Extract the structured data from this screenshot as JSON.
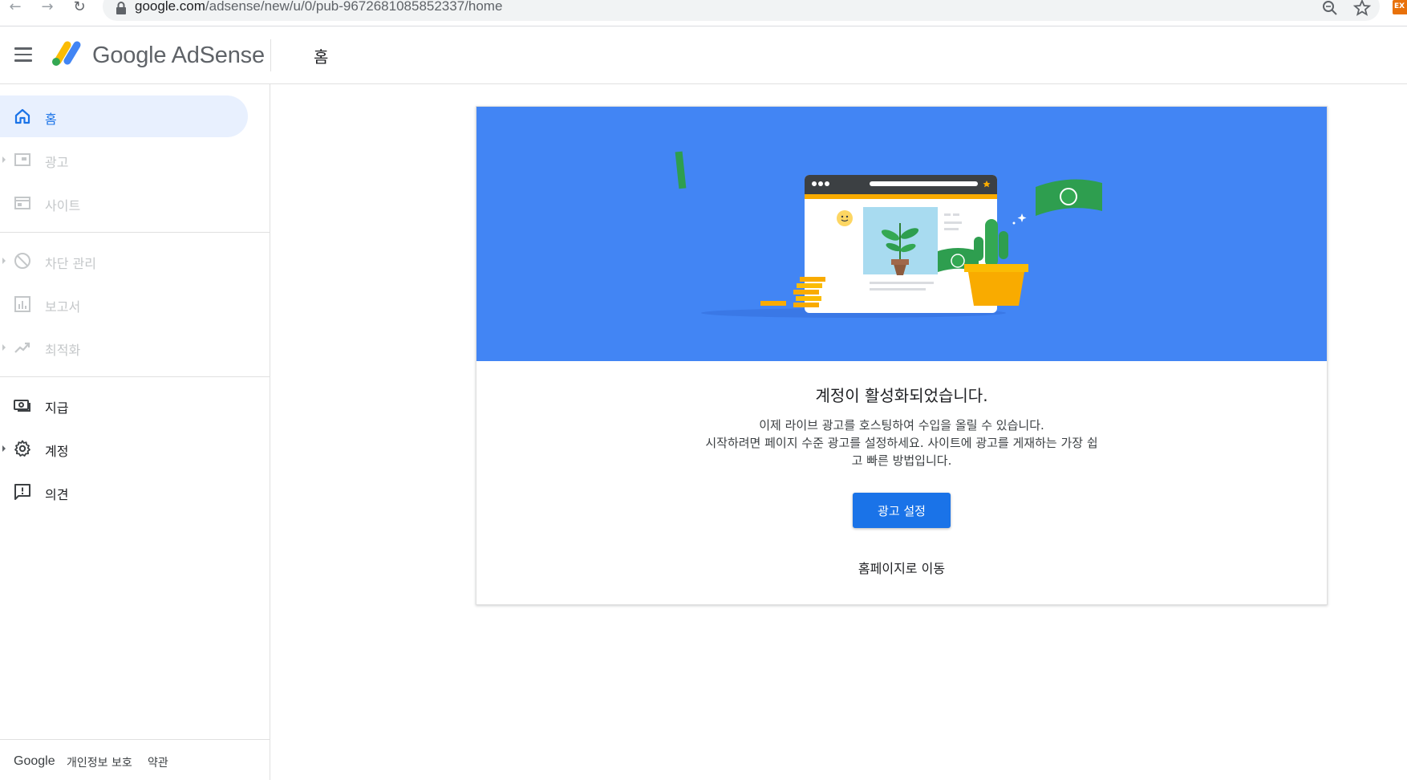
{
  "browser": {
    "url_host": "google.com",
    "url_path": "/adsense/new/u/0/pub-9672681085852337/home",
    "ext_badge": "EX"
  },
  "header": {
    "logo_text": "Google AdSense",
    "page_title": "홈"
  },
  "sidebar": {
    "items": [
      {
        "label": "홈"
      },
      {
        "label": "광고"
      },
      {
        "label": "사이트"
      },
      {
        "label": "차단 관리"
      },
      {
        "label": "보고서"
      },
      {
        "label": "최적화"
      },
      {
        "label": "지급"
      },
      {
        "label": "계정"
      },
      {
        "label": "의견"
      }
    ],
    "footer": {
      "google": "Google",
      "privacy": "개인정보 보호",
      "terms": "약관"
    }
  },
  "card": {
    "heading": "계정이 활성화되었습니다.",
    "body_line1": "이제 라이브 광고를 호스팅하여 수입을 올릴 수 있습니다.",
    "body_line2": "시작하려면 페이지 수준 광고를 설정하세요. 사이트에 광고를 게재하는 가장 쉽",
    "body_line3": "고 빠른 방법입니다.",
    "primary_button": "광고 설정",
    "secondary_link": "홈페이지로 이동"
  },
  "colors": {
    "accent": "#1a73e8",
    "banner": "#4285f4",
    "active_bg": "#e8f0fe"
  }
}
